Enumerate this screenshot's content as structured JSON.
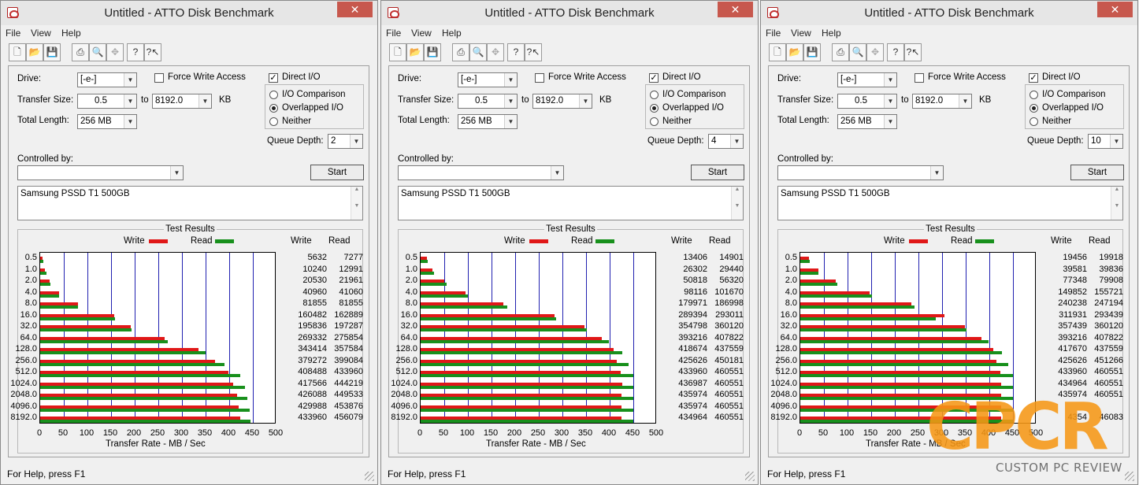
{
  "windows": [
    {
      "title": "Untitled - ATTO Disk Benchmark",
      "menu": [
        "File",
        "View",
        "Help"
      ],
      "drive_label": "Drive:",
      "drive_value": "[-e-]",
      "force_write_label": "Force Write Access",
      "direct_io_label": "Direct I/O",
      "transfer_size_label": "Transfer Size:",
      "transfer_from": "0.5",
      "to_label": "to",
      "transfer_to": "8192.0",
      "kb_label": "KB",
      "total_length_label": "Total Length:",
      "total_length": "256 MB",
      "io_comparison_label": "I/O Comparison",
      "overlapped_label": "Overlapped I/O",
      "neither_label": "Neither",
      "queue_depth_label": "Queue Depth:",
      "queue_depth": "2",
      "controlled_by_label": "Controlled by:",
      "start_label": "Start",
      "description": "Samsung PSSD T1 500GB",
      "status": "For Help, press F1",
      "chart_data": {
        "type": "bar",
        "title": "Test Results",
        "xlabel": "Transfer Rate - MB / Sec",
        "xlim": [
          0,
          500
        ],
        "xticks": [
          "0",
          "50",
          "100",
          "150",
          "200",
          "250",
          "300",
          "350",
          "400",
          "450",
          "500"
        ],
        "categories": [
          "0.5",
          "1.0",
          "2.0",
          "4.0",
          "8.0",
          "16.0",
          "32.0",
          "64.0",
          "128.0",
          "256.0",
          "512.0",
          "1024.0",
          "2048.0",
          "4096.0",
          "8192.0"
        ],
        "legend_write": "Write",
        "legend_read": "Read",
        "col_write": "Write",
        "col_read": "Read",
        "write": [
          5632,
          10240,
          20530,
          40960,
          81855,
          160482,
          195836,
          269332,
          343414,
          379272,
          408488,
          417566,
          426088,
          429988,
          433960
        ],
        "read": [
          7277,
          12991,
          21961,
          41060,
          81855,
          162889,
          197287,
          275854,
          357584,
          399084,
          433960,
          444219,
          449533,
          453876,
          456079
        ],
        "write_label": [
          "5632",
          "10240",
          "20530",
          "40960",
          "81855",
          "160482",
          "195836",
          "269332",
          "343414",
          "379272",
          "408488",
          "417566",
          "426088",
          "429988",
          "433960"
        ],
        "read_label": [
          "7277",
          "12991",
          "21961",
          "41060",
          "81855",
          "162889",
          "197287",
          "275854",
          "357584",
          "399084",
          "433960",
          "444219",
          "449533",
          "453876",
          "456079"
        ]
      }
    },
    {
      "title": "Untitled - ATTO Disk Benchmark",
      "menu": [
        "File",
        "View",
        "Help"
      ],
      "drive_label": "Drive:",
      "drive_value": "[-e-]",
      "force_write_label": "Force Write Access",
      "direct_io_label": "Direct I/O",
      "transfer_size_label": "Transfer Size:",
      "transfer_from": "0.5",
      "to_label": "to",
      "transfer_to": "8192.0",
      "kb_label": "KB",
      "total_length_label": "Total Length:",
      "total_length": "256 MB",
      "io_comparison_label": "I/O Comparison",
      "overlapped_label": "Overlapped I/O",
      "neither_label": "Neither",
      "queue_depth_label": "Queue Depth:",
      "queue_depth": "4",
      "controlled_by_label": "Controlled by:",
      "start_label": "Start",
      "description": "Samsung PSSD T1 500GB",
      "status": "For Help, press F1",
      "chart_data": {
        "type": "bar",
        "title": "Test Results",
        "xlabel": "Transfer Rate - MB / Sec",
        "xlim": [
          0,
          500
        ],
        "xticks": [
          "0",
          "50",
          "100",
          "150",
          "200",
          "250",
          "300",
          "350",
          "400",
          "450",
          "500"
        ],
        "categories": [
          "0.5",
          "1.0",
          "2.0",
          "4.0",
          "8.0",
          "16.0",
          "32.0",
          "64.0",
          "128.0",
          "256.0",
          "512.0",
          "1024.0",
          "2048.0",
          "4096.0",
          "8192.0"
        ],
        "legend_write": "Write",
        "legend_read": "Read",
        "col_write": "Write",
        "col_read": "Read",
        "write": [
          13406,
          26302,
          50818,
          98116,
          179971,
          289394,
          354798,
          393216,
          418674,
          425626,
          433960,
          436987,
          435974,
          435974,
          434964
        ],
        "read": [
          14901,
          29440,
          56320,
          101670,
          186998,
          293011,
          360120,
          407822,
          437559,
          450181,
          460551,
          460551,
          460551,
          460551,
          460551
        ],
        "write_label": [
          "13406",
          "26302",
          "50818",
          "98116",
          "179971",
          "289394",
          "354798",
          "393216",
          "418674",
          "425626",
          "433960",
          "436987",
          "435974",
          "435974",
          "434964"
        ],
        "read_label": [
          "14901",
          "29440",
          "56320",
          "101670",
          "186998",
          "293011",
          "360120",
          "407822",
          "437559",
          "450181",
          "460551",
          "460551",
          "460551",
          "460551",
          "460551"
        ]
      }
    },
    {
      "title": "Untitled - ATTO Disk Benchmark",
      "menu": [
        "File",
        "View",
        "Help"
      ],
      "drive_label": "Drive:",
      "drive_value": "[-e-]",
      "force_write_label": "Force Write Access",
      "direct_io_label": "Direct I/O",
      "transfer_size_label": "Transfer Size:",
      "transfer_from": "0.5",
      "to_label": "to",
      "transfer_to": "8192.0",
      "kb_label": "KB",
      "total_length_label": "Total Length:",
      "total_length": "256 MB",
      "io_comparison_label": "I/O Comparison",
      "overlapped_label": "Overlapped I/O",
      "neither_label": "Neither",
      "queue_depth_label": "Queue Depth:",
      "queue_depth": "10",
      "controlled_by_label": "Controlled by:",
      "start_label": "Start",
      "description": "Samsung PSSD T1 500GB",
      "status": "For Help, press F1",
      "chart_data": {
        "type": "bar",
        "title": "Test Results",
        "xlabel": "Transfer Rate - MB / Sec",
        "xlim": [
          0,
          500
        ],
        "xticks": [
          "0",
          "50",
          "100",
          "150",
          "200",
          "250",
          "300",
          "350",
          "400",
          "450",
          "500"
        ],
        "categories": [
          "0.5",
          "1.0",
          "2.0",
          "4.0",
          "8.0",
          "16.0",
          "32.0",
          "64.0",
          "128.0",
          "256.0",
          "512.0",
          "1024.0",
          "2048.0",
          "4096.0",
          "8192.0"
        ],
        "legend_write": "Write",
        "legend_read": "Read",
        "col_write": "Write",
        "col_read": "Read",
        "write": [
          19456,
          39581,
          77348,
          149852,
          240238,
          311931,
          357439,
          393216,
          417670,
          425626,
          433960,
          434964,
          435974,
          435974,
          435974
        ],
        "read": [
          19918,
          39836,
          79908,
          155721,
          247194,
          293439,
          360120,
          407822,
          437559,
          451266,
          460551,
          460551,
          460551,
          460551,
          460830
        ],
        "write_label": [
          "19456",
          "39581",
          "77348",
          "149852",
          "240238",
          "311931",
          "357439",
          "393216",
          "417670",
          "425626",
          "433960",
          "434964",
          "435974",
          "",
          "4354"
        ],
        "read_label": [
          "19918",
          "39836",
          "79908",
          "155721",
          "247194",
          "293439",
          "360120",
          "407822",
          "437559",
          "451266",
          "460551",
          "460551",
          "460551",
          "",
          "46083"
        ]
      }
    }
  ],
  "watermark": {
    "logo": "CPCR",
    "subtitle": "CUSTOM PC REVIEW"
  },
  "colors": {
    "write": "#e01818",
    "read": "#18901c",
    "grid": "#2020b0",
    "watermark": "#f59614"
  }
}
